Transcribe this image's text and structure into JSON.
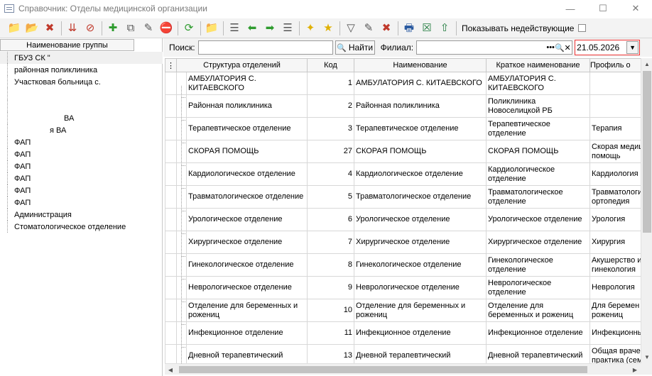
{
  "window": {
    "title": "Справочник: Отделы медицинской организации"
  },
  "toolbar": {
    "icons": [
      "add-folder-icon",
      "open-folder-icon",
      "delete-folder-icon",
      "filter-add-icon",
      "filter-remove-icon",
      "add-icon",
      "copy-icon",
      "edit-icon",
      "delete-icon",
      "refresh-icon",
      "filter-folder-icon",
      "list-icon",
      "arrow-left-icon",
      "arrow-right-icon",
      "list2-icon",
      "star-add-icon",
      "star-icon",
      "filter-icon",
      "filter-edit-icon",
      "filter-clear-icon",
      "print-icon",
      "excel-icon",
      "export-icon"
    ],
    "show_inactive_label": "Показывать недействующие"
  },
  "left_pane": {
    "header": "Наименование группы",
    "items": [
      "ГБУЗ СК \"",
      "районная поликлиника",
      "Участковая больница с.",
      "",
      "",
      "ВА",
      "я ВА",
      "ФАП",
      "ФАП",
      "ФАП",
      "ФАП",
      "ФАП",
      "ФАП",
      "Администрация",
      "Стоматологическое отделение"
    ]
  },
  "search": {
    "label": "Поиск:",
    "value": "",
    "find_label": "Найти"
  },
  "branch": {
    "label": "Филиал:",
    "value": "",
    "dots": "•••",
    "search_glyph": "🔍",
    "clear_glyph": "✕"
  },
  "date": {
    "value": "21.05.2026"
  },
  "grid": {
    "columns": [
      "Структура отделений",
      "Код",
      "Наименование",
      "Краткое наименование",
      "Профиль о"
    ],
    "rows": [
      {
        "s": "АМБУЛАТОРИЯ С. КИТАЕВСКОГО",
        "c": "1",
        "n": "АМБУЛАТОРИЯ С. КИТАЕВСКОГО",
        "k": "АМБУЛАТОРИЯ С. КИТАЕВСКОГО",
        "p": ""
      },
      {
        "s": "Районная поликлиника",
        "c": "2",
        "n": "Районная поликлиника",
        "k": "Поликлиника Новоселицкой РБ",
        "p": ""
      },
      {
        "s": "Терапевтическое отделение",
        "c": "3",
        "n": "Терапевтическое отделение",
        "k": "Терапевтическое отделение",
        "p": "Терапия"
      },
      {
        "s": "СКОРАЯ ПОМОЩЬ",
        "c": "27",
        "n": "СКОРАЯ ПОМОЩЬ",
        "k": "СКОРАЯ ПОМОЩЬ",
        "p": "Скорая медиц помощь"
      },
      {
        "s": "Кардиологическое отделение",
        "c": "4",
        "n": "Кардиологическое отделение",
        "k": "Кардиологическое отделение",
        "p": "Кардиология"
      },
      {
        "s": "Травматологическое отделение",
        "c": "5",
        "n": "Травматологическое отделение",
        "k": "Травматологическое отделение",
        "p": "Травматологи ортопедия"
      },
      {
        "s": "Урологическое отделение",
        "c": "6",
        "n": "Урологическое отделение",
        "k": "Урологическое отделение",
        "p": "Урология"
      },
      {
        "s": "Хирургическое отделение",
        "c": "7",
        "n": "Хирургическое отделение",
        "k": "Хирургическое отделение",
        "p": "Хирургия"
      },
      {
        "s": "Гинекологическое отделение",
        "c": "8",
        "n": "Гинекологическое отделение",
        "k": "Гинекологическое отделение",
        "p": "Акушерство и гинекология"
      },
      {
        "s": "Неврологическое отделение",
        "c": "9",
        "n": "Неврологическое отделение",
        "k": "Неврологическое отделение",
        "p": "Неврология"
      },
      {
        "s": "Отделение для беременных и рожениц",
        "c": "10",
        "n": "Отделение для беременных и рожениц",
        "k": "Отделение для беременных и рожениц",
        "p": "Для беремен рожениц"
      },
      {
        "s": "Инфекционное отделение",
        "c": "11",
        "n": "Инфекционное отделение",
        "k": "Инфекционное отделение",
        "p": "Инфекционны"
      },
      {
        "s": "Дневной терапевтический",
        "c": "13",
        "n": "Дневной терапевтический",
        "k": "Дневной терапевтический",
        "p": "Общая враче практика (сем"
      }
    ]
  }
}
